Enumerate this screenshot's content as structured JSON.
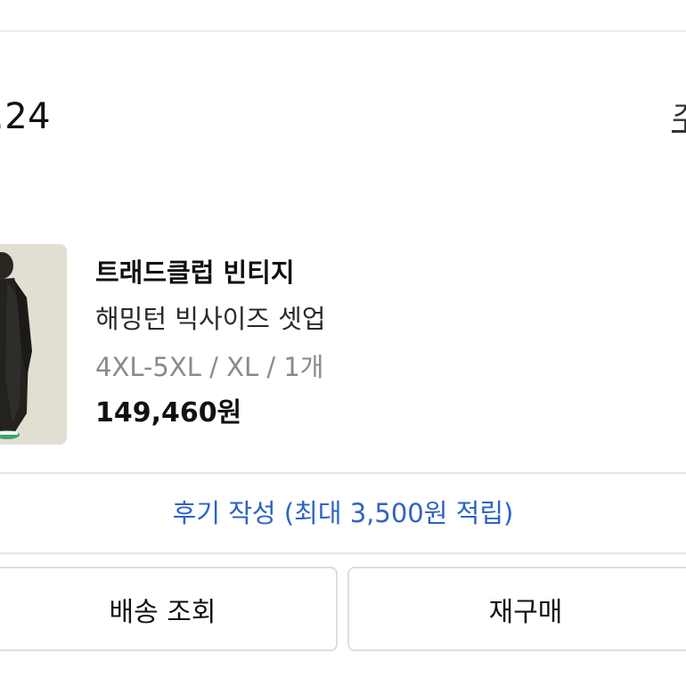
{
  "order": {
    "number": ".24",
    "detail_link_fragment": "주",
    "status_fragment": "!"
  },
  "product": {
    "brand": "트래드클럽 빈티지",
    "name": "해밍턴 빅사이즈 셋업",
    "option": "4XL-5XL / XL / 1개",
    "price": "149,460원"
  },
  "review": {
    "label": "후기 작성 (최대 3,500원 적립)"
  },
  "buttons": {
    "delivery": "배송 조회",
    "reorder": "재구매"
  },
  "colors": {
    "review_link": "#2f63c4",
    "thumbnail_bg": "#dcdccf"
  },
  "icons": {
    "product_thumbnail": "product-photo-black-coat"
  }
}
